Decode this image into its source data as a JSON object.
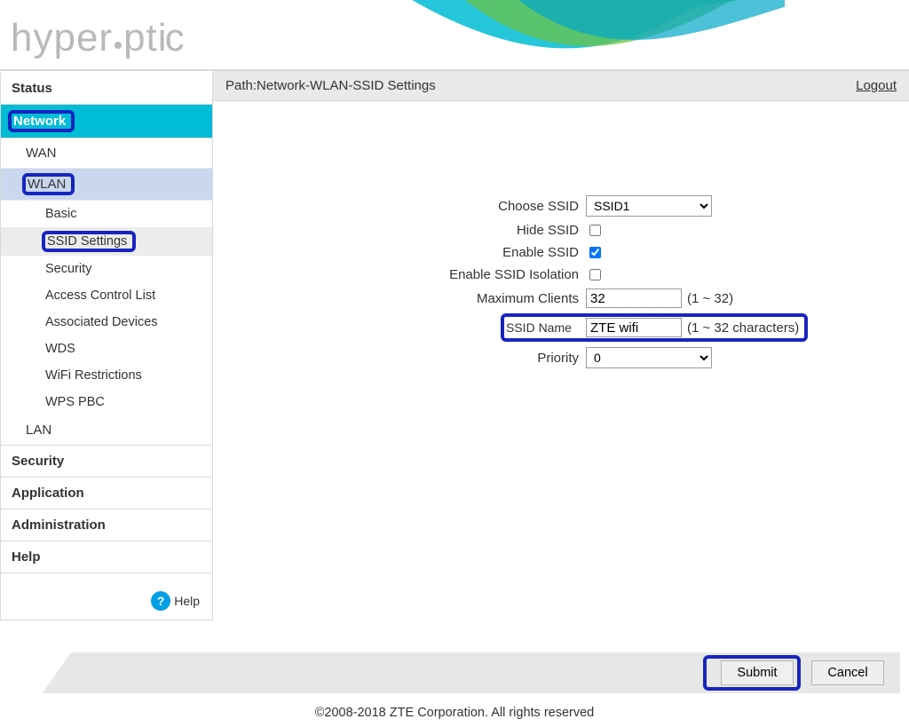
{
  "brand": "hyperoptic",
  "sidebar": {
    "status": "Status",
    "network": "Network",
    "wan": "WAN",
    "wlan": "WLAN",
    "basic": "Basic",
    "ssid_settings": "SSID Settings",
    "security": "Security",
    "acl": "Access Control List",
    "assoc": "Associated Devices",
    "wds": "WDS",
    "wifi_restrictions": "WiFi Restrictions",
    "wps_pbc": "WPS PBC",
    "lan": "LAN",
    "security_top": "Security",
    "application": "Application",
    "administration": "Administration",
    "help": "Help",
    "help_link": "Help"
  },
  "pathbar": {
    "label": "Path:Network-WLAN-SSID Settings",
    "logout": "Logout"
  },
  "form": {
    "choose_ssid_label": "Choose SSID",
    "choose_ssid_value": "SSID1",
    "hide_ssid_label": "Hide SSID",
    "hide_ssid_checked": false,
    "enable_ssid_label": "Enable SSID",
    "enable_ssid_checked": true,
    "iso_label": "Enable SSID Isolation",
    "iso_checked": false,
    "max_clients_label": "Maximum Clients",
    "max_clients_value": "32",
    "max_clients_hint": "(1 ~ 32)",
    "ssid_name_label": "SSID Name",
    "ssid_name_value": "ZTE wifi",
    "ssid_name_hint": "(1 ~ 32 characters)",
    "priority_label": "Priority",
    "priority_value": "0"
  },
  "actions": {
    "submit": "Submit",
    "cancel": "Cancel"
  },
  "copyright": "©2008-2018 ZTE Corporation. All rights reserved"
}
